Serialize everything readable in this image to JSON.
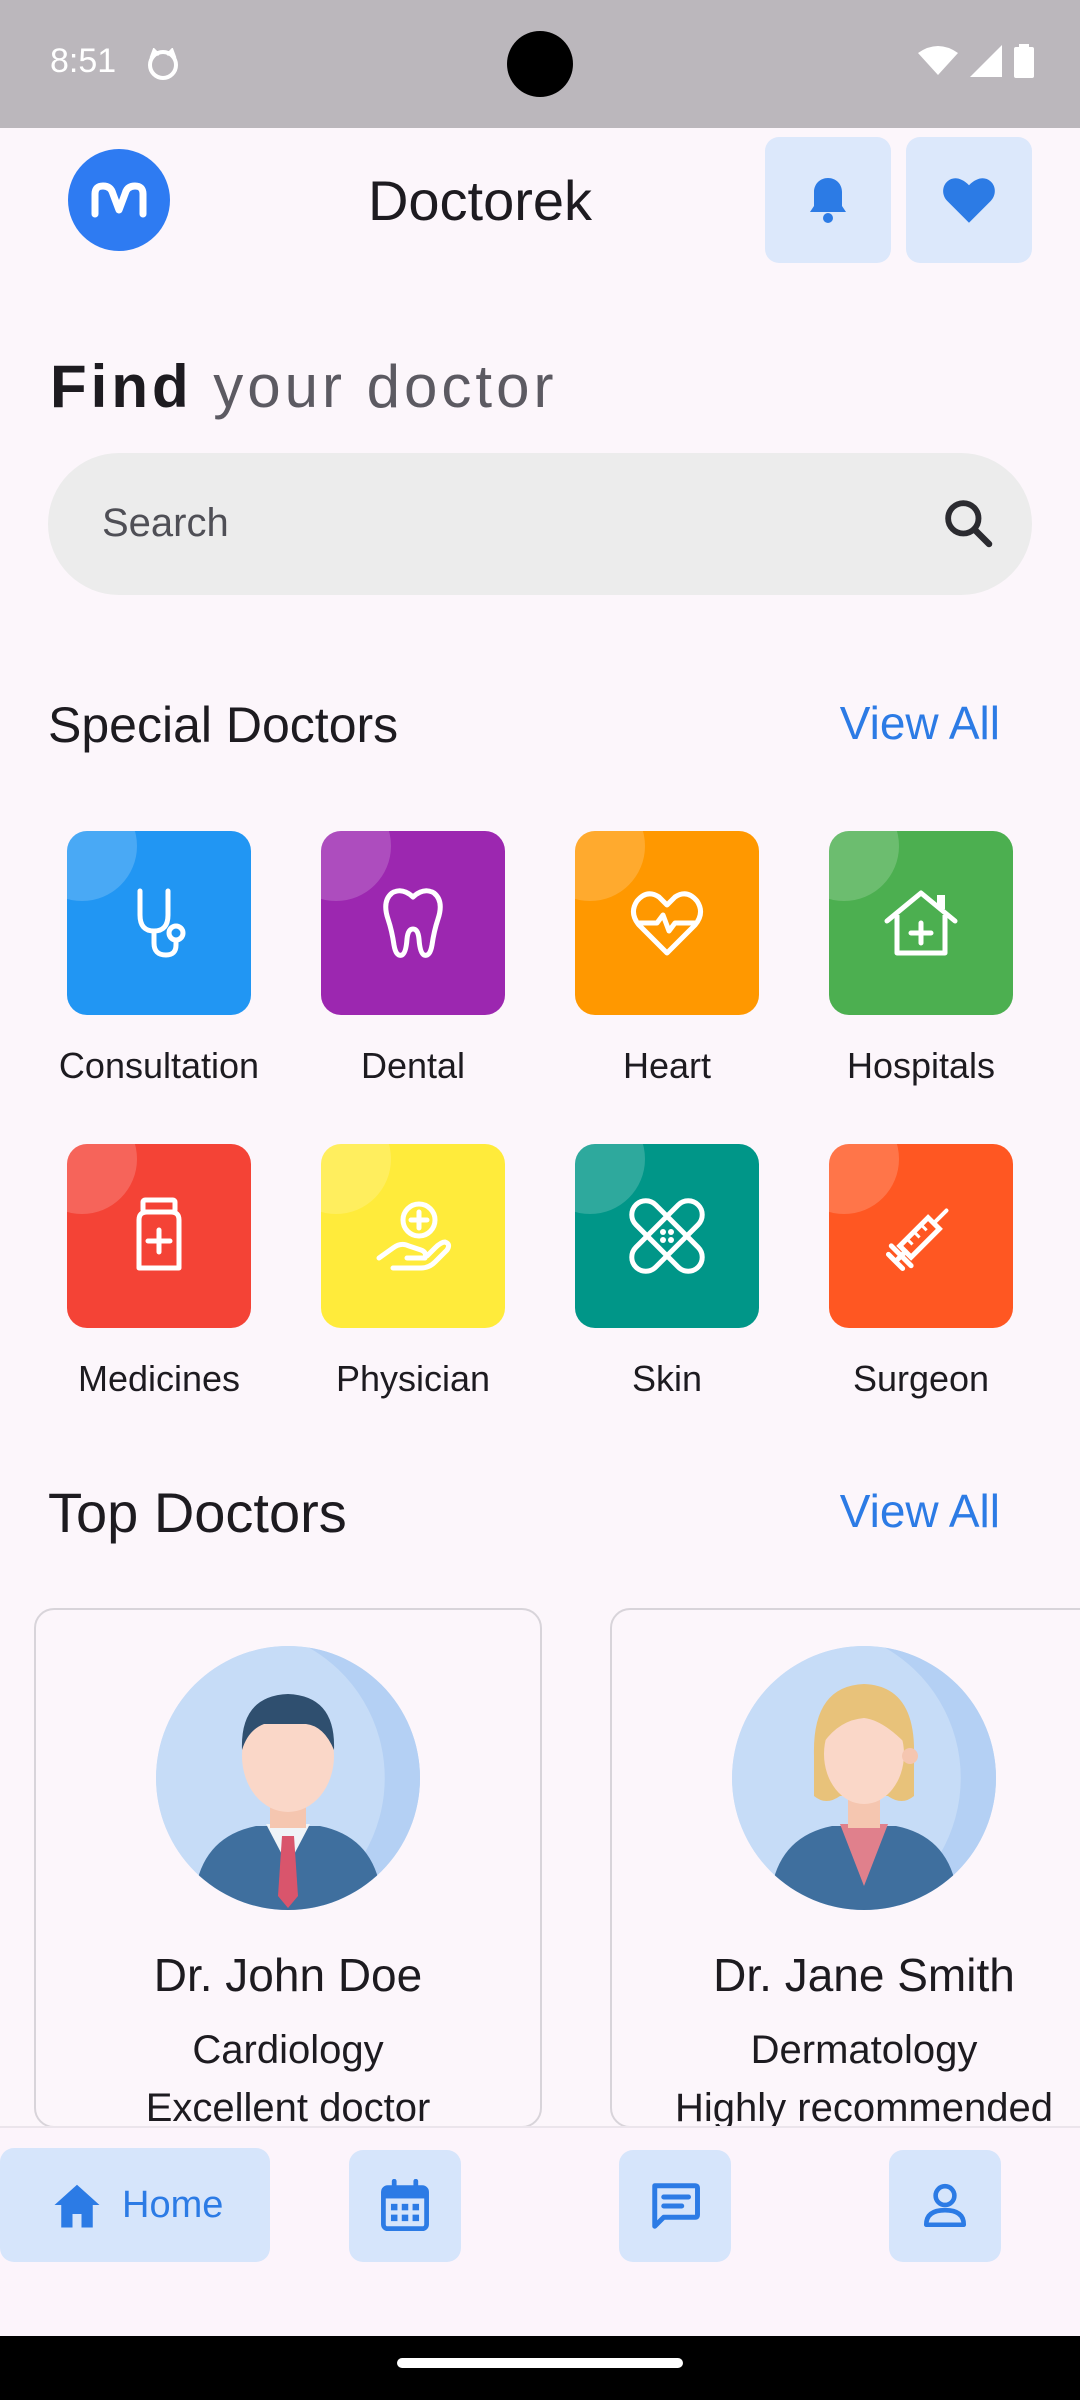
{
  "status_bar": {
    "time": "8:51"
  },
  "header": {
    "title": "Doctorek",
    "logo_icon": "mm-logo-icon",
    "notification_icon": "bell-icon",
    "favorites_icon": "heart-icon"
  },
  "find": {
    "strong": "Find",
    "light": "your doctor"
  },
  "search": {
    "placeholder": "Search"
  },
  "special": {
    "title": "Special Doctors",
    "view_all": "View All",
    "items": [
      {
        "label": "Consultation",
        "color": "#2196f3",
        "icon": "stethoscope-icon"
      },
      {
        "label": "Dental",
        "color": "#9c27b0",
        "icon": "tooth-icon"
      },
      {
        "label": "Heart",
        "color": "#ff9800",
        "icon": "heart-pulse-icon"
      },
      {
        "label": "Hospitals",
        "color": "#4caf50",
        "icon": "hospital-icon"
      },
      {
        "label": "Medicines",
        "color": "#f44336",
        "icon": "medicine-bottle-icon"
      },
      {
        "label": "Physician",
        "color": "#ffeb3b",
        "icon": "hand-plus-icon"
      },
      {
        "label": "Skin",
        "color": "#009688",
        "icon": "bandage-icon"
      },
      {
        "label": "Surgeon",
        "color": "#ff5722",
        "icon": "syringe-icon"
      }
    ]
  },
  "top": {
    "title": "Top Doctors",
    "view_all": "View All",
    "doctors": [
      {
        "name": "Dr. John Doe",
        "specialty": "Cardiology",
        "description": "Excellent doctor"
      },
      {
        "name": "Dr. Jane Smith",
        "specialty": "Dermatology",
        "description": "Highly recommended"
      }
    ]
  },
  "nav": {
    "home_label": "Home",
    "accent": "#2c7be5"
  }
}
